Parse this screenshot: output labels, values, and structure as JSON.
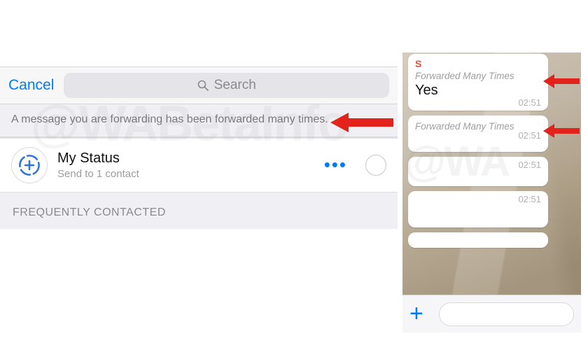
{
  "left": {
    "cancel": "Cancel",
    "search_placeholder": "Search",
    "banner": "A message you are forwarding has been forwarded many times.",
    "status": {
      "title": "My Status",
      "subtitle": "Send to 1 contact",
      "more": "•••"
    },
    "section": "FREQUENTLY CONTACTED",
    "watermark": "@WABetaInfo"
  },
  "right": {
    "bubbles": [
      {
        "sender": "S",
        "fwd": "Forwarded Many Times",
        "msg": "Yes",
        "time": "02:51"
      },
      {
        "fwd": "Forwarded Many Times",
        "time": "02:51"
      },
      {
        "time": "02:51"
      },
      {
        "time": "02:51"
      }
    ],
    "watermark": "@WA"
  }
}
